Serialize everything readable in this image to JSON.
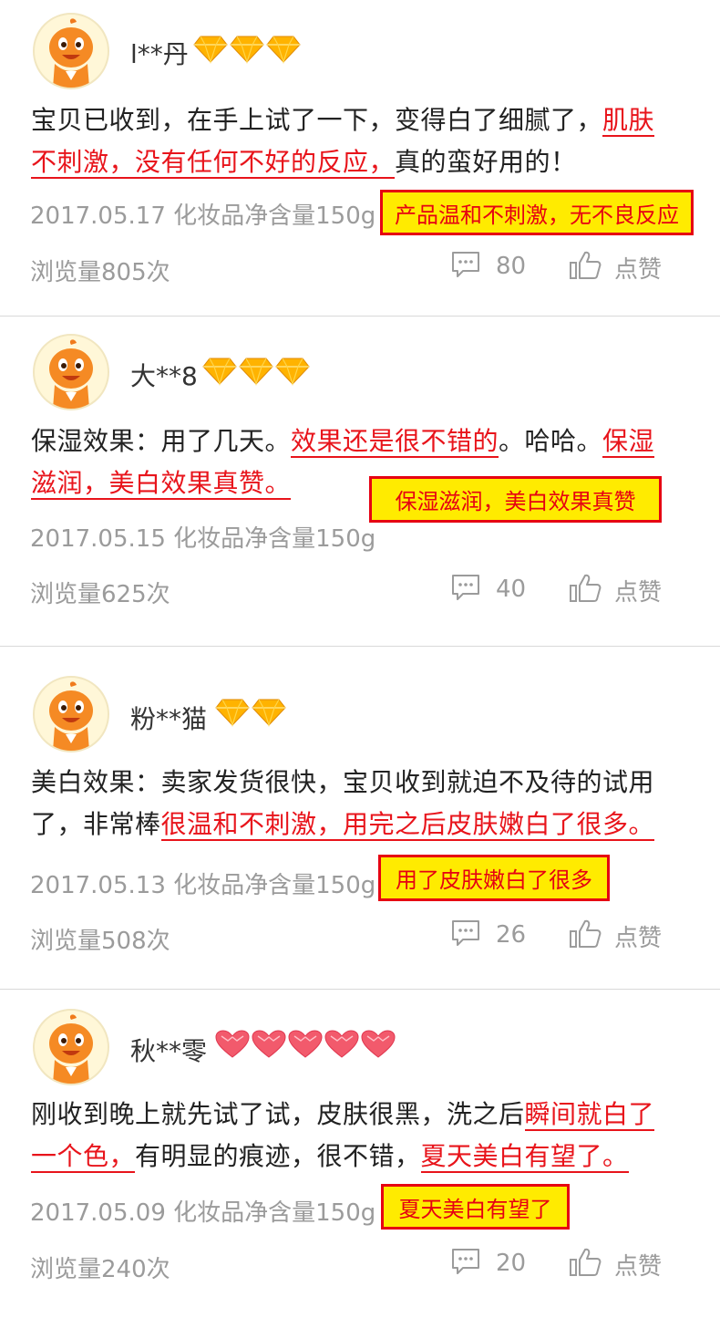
{
  "reviews": [
    {
      "username": "l**丹",
      "badge_type": "diamond-icon",
      "badge_count": 3,
      "content": [
        {
          "text": "宝贝已收到，在手上试了一下，变得白了细腻了，",
          "hl": false
        },
        {
          "text": "肌肤不刺激，没有任何不好的反应，",
          "hl": true
        },
        {
          "text": "真的蛮好用的！",
          "hl": false
        }
      ],
      "meta": "2017.05.17 化妆品净含量150g",
      "note": "产品温和不刺激，无不良反应",
      "views": "浏览量805次",
      "comments": "80",
      "like": "点赞"
    },
    {
      "username": "大**8",
      "badge_type": "diamond-icon",
      "badge_count": 3,
      "content": [
        {
          "text": "保湿效果：用了几天。",
          "hl": false
        },
        {
          "text": "效果还是很不错的",
          "hl": true
        },
        {
          "text": "。哈哈。",
          "hl": false
        },
        {
          "text": "保湿滋润，美白效果真赞。",
          "hl": true
        }
      ],
      "meta": "2017.05.15 化妆品净含量150g",
      "note": "保湿滋润，美白效果真赞",
      "views": "浏览量625次",
      "comments": "40",
      "like": "点赞"
    },
    {
      "username": "粉**猫",
      "badge_type": "diamond-icon",
      "badge_count": 2,
      "content": [
        {
          "text": "美白效果：卖家发货很快，宝贝收到就迫不及待的试用了，非常棒",
          "hl": false
        },
        {
          "text": "很温和不刺激，用完之后皮肤嫩白了很多。",
          "hl": true
        }
      ],
      "meta": "2017.05.13 化妆品净含量150g",
      "note": "用了皮肤嫩白了很多",
      "views": "浏览量508次",
      "comments": "26",
      "like": "点赞"
    },
    {
      "username": "秋**零",
      "badge_type": "heart-icon",
      "badge_count": 5,
      "content": [
        {
          "text": "刚收到晚上就先试了试，皮肤很黑，洗之后",
          "hl": false
        },
        {
          "text": "瞬间就白了一个色，",
          "hl": true
        },
        {
          "text": "有明显的痕迹，很不错，",
          "hl": false
        },
        {
          "text": "夏天美白有望了。",
          "hl": true
        }
      ],
      "meta": "2017.05.09 化妆品净含量150g",
      "note": "夏天美白有望了",
      "views": "浏览量240次",
      "comments": "20",
      "like": "点赞"
    }
  ],
  "colors": {
    "highlight": "#e8141b",
    "note_bg": "#ffeb00",
    "note_border": "#e60012",
    "meta": "#9b9b9b"
  }
}
